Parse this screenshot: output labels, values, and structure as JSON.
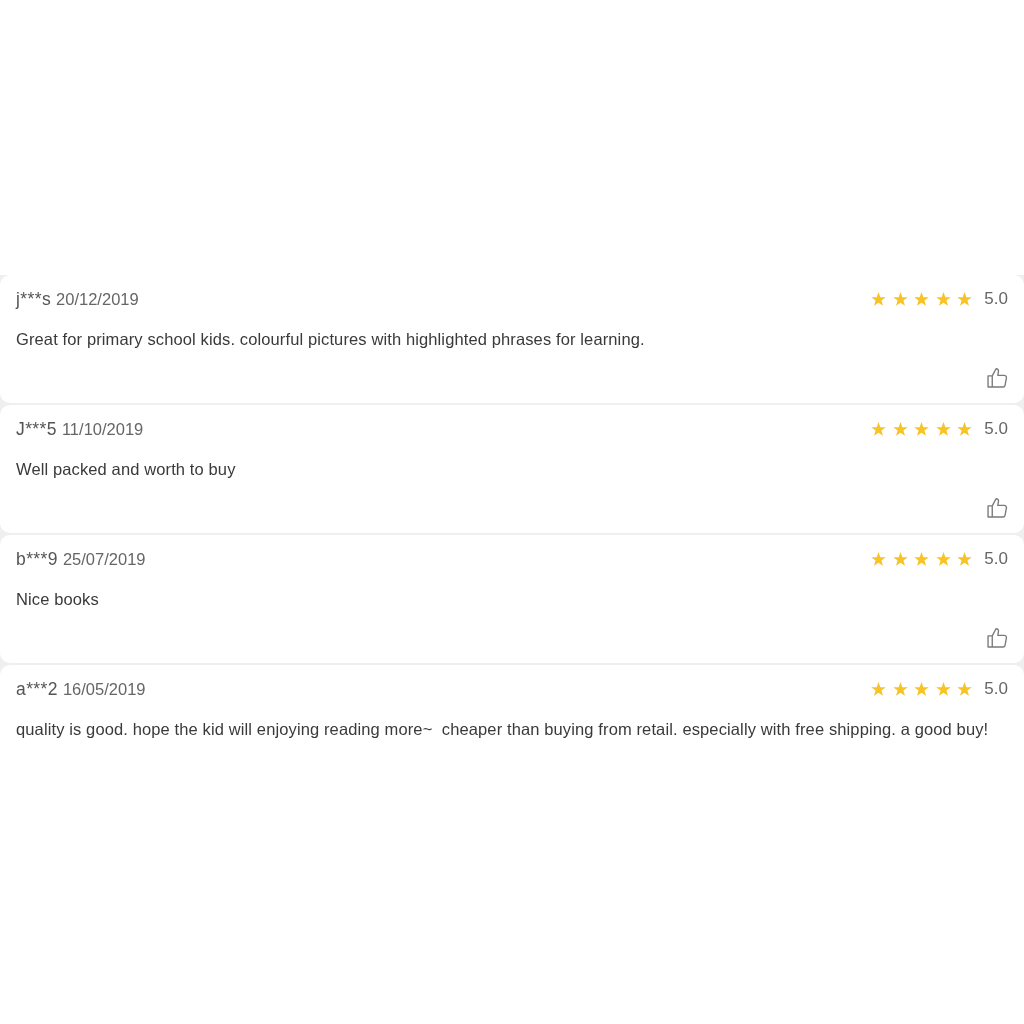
{
  "reviews": [
    {
      "user": "j***s",
      "date": "20/12/2019",
      "stars": 5,
      "rating": "5.0",
      "text": "Great for primary school kids. colourful pictures with highlighted phrases for learning.",
      "cut_off": false
    },
    {
      "user": "J***5",
      "date": "11/10/2019",
      "stars": 5,
      "rating": "5.0",
      "text": "Well packed and worth to buy",
      "cut_off": false
    },
    {
      "user": "b***9",
      "date": "25/07/2019",
      "stars": 5,
      "rating": "5.0",
      "text": "Nice books",
      "cut_off": false
    },
    {
      "user": "a***2",
      "date": "16/05/2019",
      "stars": 5,
      "rating": "5.0",
      "text": "quality is good. hope the kid will enjoying reading more~  cheaper than buying from retail. especially with free shipping. a good buy!",
      "cut_off": true
    }
  ]
}
